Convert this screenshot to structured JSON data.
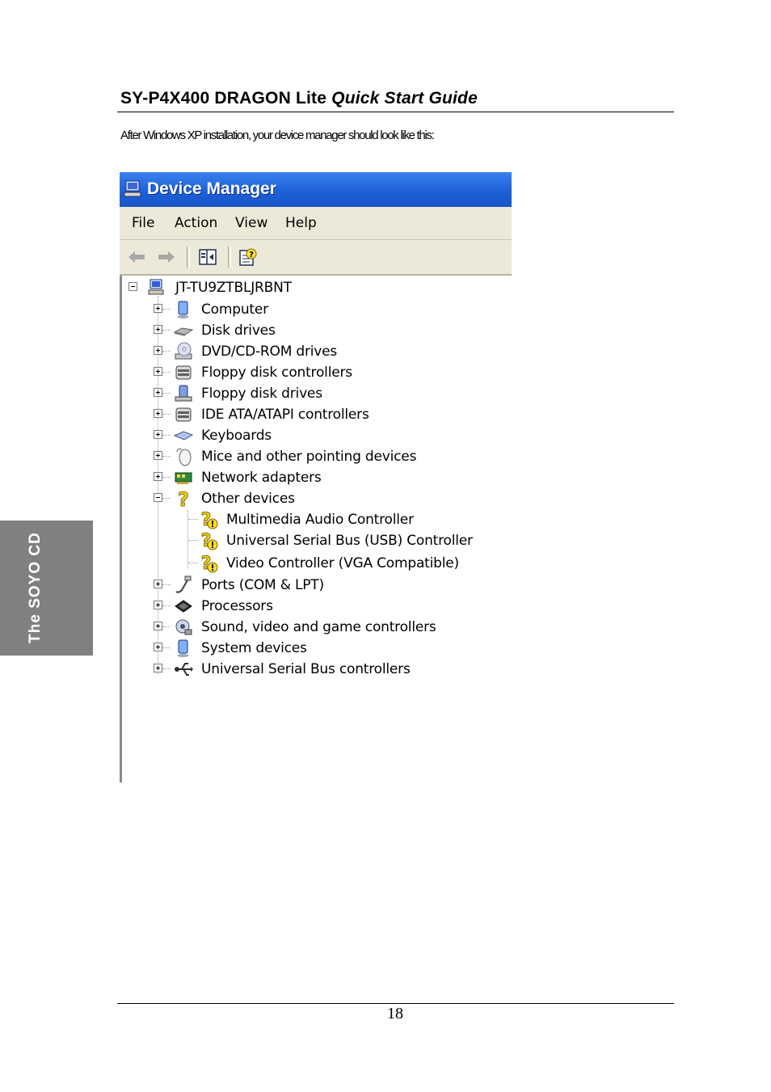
{
  "header": {
    "product": "SY-P4X400 DRAGON Lite",
    "guide": "Quick Start Guide"
  },
  "intro_text": "After Windows XP installation, your device manager should look like this:",
  "side_tab": "The SOYO CD",
  "page_number": "18",
  "device_manager": {
    "title": "Device Manager",
    "menu": [
      "File",
      "Action",
      "View",
      "Help"
    ],
    "toolbar_icons": [
      "back-arrow-icon",
      "forward-arrow-icon",
      "properties-pane-icon",
      "help-icon"
    ],
    "root": "JT-TU9ZTBLJRBNT",
    "nodes": [
      {
        "label": "Computer",
        "icon": "computer-icon"
      },
      {
        "label": "Disk drives",
        "icon": "disk-drive-icon"
      },
      {
        "label": "DVD/CD-ROM drives",
        "icon": "cdrom-icon"
      },
      {
        "label": "Floppy disk controllers",
        "icon": "controller-icon"
      },
      {
        "label": "Floppy disk drives",
        "icon": "floppy-drive-icon"
      },
      {
        "label": "IDE ATA/ATAPI controllers",
        "icon": "controller-icon"
      },
      {
        "label": "Keyboards",
        "icon": "keyboard-icon"
      },
      {
        "label": "Mice and other pointing devices",
        "icon": "mouse-icon"
      },
      {
        "label": "Network adapters",
        "icon": "network-icon"
      },
      {
        "label": "Other devices",
        "icon": "question-icon",
        "expanded": true,
        "children": [
          {
            "label": "Multimedia Audio Controller",
            "icon": "question-warning-icon"
          },
          {
            "label": "Universal Serial Bus (USB) Controller",
            "icon": "question-warning-icon"
          },
          {
            "label": "Video Controller (VGA Compatible)",
            "icon": "question-warning-icon"
          }
        ]
      },
      {
        "label": "Ports (COM & LPT)",
        "icon": "port-icon"
      },
      {
        "label": "Processors",
        "icon": "processor-icon"
      },
      {
        "label": "Sound, video and game controllers",
        "icon": "sound-icon"
      },
      {
        "label": "System devices",
        "icon": "system-icon"
      },
      {
        "label": "Universal Serial Bus controllers",
        "icon": "usb-icon"
      }
    ]
  }
}
